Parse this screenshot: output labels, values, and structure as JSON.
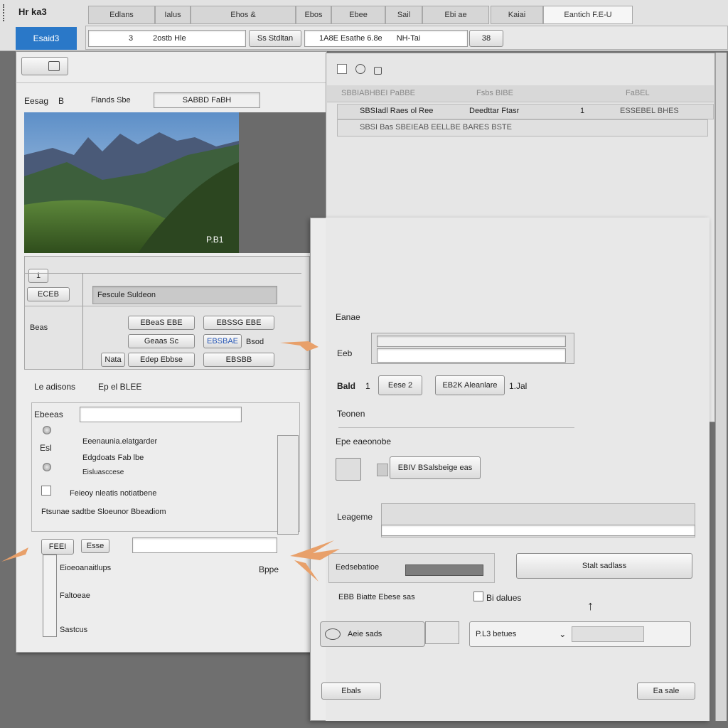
{
  "top": {
    "app_title": "Hr ka3",
    "tabs": [
      "Edlans",
      "Ialus",
      "Ehos &",
      "Ebos",
      "Ebee",
      "Sail",
      "Ebi ae"
    ],
    "tab_right": "Kaiai",
    "search_label": "Eantich F.E-U",
    "blue_button": "Esaid3",
    "field1": "3",
    "field1_text": "2ostb Hle",
    "field2": "Ss Stdltan",
    "field3": "1A8E Esathe 6.8e",
    "field3_tail": "NH-Tai",
    "field4": "38"
  },
  "left": {
    "section_label": "Eesag",
    "section_num": "B",
    "prop_label": "Flands Sbe",
    "prop_value": "SABBD FaBH",
    "photo_caption": "P.B1",
    "panel_tab": "1",
    "tree_item": "ECEB",
    "tree_header": "Fescule Suldeon",
    "side_label": "Beas",
    "buttons": [
      "EBeaS EBE",
      "EBSSG EBE",
      "Geaas Sc",
      "EBSBAE",
      "Nata",
      "Edep Ebbse",
      "EBSBB"
    ],
    "bold_label": "Bsod",
    "sub_header": "Le adisons",
    "sub_header2": "Ep el BLEE",
    "field_label": "Ebeeas",
    "radio_group_label": "Esl",
    "radio_items": [
      "Eeenaunia.elatgarder",
      "Edgdoats Fab lbe",
      "Eisluasccese"
    ],
    "check_item": "Feieoy nleatis notiatbene",
    "long_label": "Ftsunae sadtbe Sloeunor Bbeadiom",
    "small_btn1": "FEEI",
    "small_btn2": "Esse",
    "list_items": [
      "Eioeoanaitlups",
      "Faltoeae",
      "Sastcus"
    ],
    "list_side": "Bppe"
  },
  "right": {
    "title_icons": [
      "square-icon",
      "circle-icon",
      "lock-icon"
    ],
    "header_row1": [
      "SBBIABHBEI PaBBE",
      "Fsbs BIBE",
      "FaBEL"
    ],
    "header_row2": [
      "SBSIadl Raes ol Ree",
      "Deedttar Ftasr",
      "1",
      "ESSEBEL BHES"
    ],
    "header_row3": "SBSI Bas SBEIEAB EELLBE BARES BSTE",
    "label_frame": "Eanae",
    "label_beb": "Eeb",
    "label_bald": "Bald",
    "bald_num": "1",
    "btn_bald1": "Eese 2",
    "btn_bald2": "EB2K Aleanlare",
    "bald_tail": "1.Jal",
    "label_tonen": "Teonen",
    "section_type": "Epe eaeonobe",
    "type_btn": "EBIV BSalsbeige eas",
    "label_language": "Leageme",
    "label_bottom_left": "Eedsebatioe",
    "btn_bottom_right": "Stalt sadlass",
    "check_row_label": "EBB Biatte Ebese sas",
    "check_label2": "Bi dalues",
    "dropdown_left": "Aeie sads",
    "dropdown_right": "P.L3 betues",
    "footer_left": "Ebals",
    "footer_right": "Ea sale"
  }
}
